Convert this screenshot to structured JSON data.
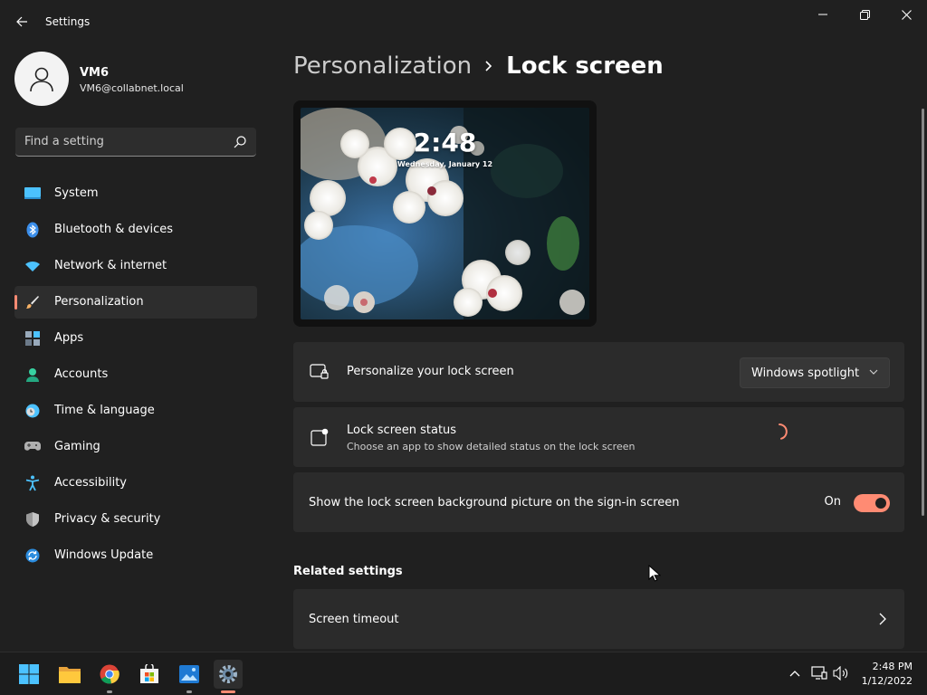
{
  "window": {
    "title": "Settings"
  },
  "user": {
    "name": "VM6",
    "email": "VM6@collabnet.local"
  },
  "search": {
    "placeholder": "Find a setting"
  },
  "sidebar": {
    "items": [
      {
        "label": "System",
        "icon": "monitor-icon"
      },
      {
        "label": "Bluetooth & devices",
        "icon": "bluetooth-icon"
      },
      {
        "label": "Network & internet",
        "icon": "wifi-icon"
      },
      {
        "label": "Personalization",
        "icon": "brush-icon",
        "active": true
      },
      {
        "label": "Apps",
        "icon": "apps-icon"
      },
      {
        "label": "Accounts",
        "icon": "person-icon"
      },
      {
        "label": "Time & language",
        "icon": "clock-globe-icon"
      },
      {
        "label": "Gaming",
        "icon": "gamepad-icon"
      },
      {
        "label": "Accessibility",
        "icon": "accessibility-icon"
      },
      {
        "label": "Privacy & security",
        "icon": "shield-icon"
      },
      {
        "label": "Windows Update",
        "icon": "update-icon"
      }
    ]
  },
  "breadcrumb": {
    "parent": "Personalization",
    "current": "Lock screen"
  },
  "preview": {
    "time": "2:48",
    "date": "Wednesday, January 12"
  },
  "cards": {
    "personalize": {
      "title": "Personalize your lock screen",
      "value": "Windows spotlight"
    },
    "status": {
      "title": "Lock screen status",
      "subtitle": "Choose an app to show detailed status on the lock screen"
    },
    "signin": {
      "title": "Show the lock screen background picture on the sign-in screen",
      "toggle_label": "On",
      "toggle_on": true
    }
  },
  "related": {
    "header": "Related settings",
    "items": [
      {
        "label": "Screen timeout"
      }
    ]
  },
  "taskbar": {
    "apps": [
      "start-icon",
      "file-explorer-icon",
      "chrome-icon",
      "store-icon",
      "photos-icon",
      "settings-icon"
    ],
    "clock_time": "2:48 PM",
    "clock_date": "1/12/2022"
  },
  "colors": {
    "accent": "#ff8b73",
    "background": "#202020",
    "card": "#2b2b2b"
  }
}
